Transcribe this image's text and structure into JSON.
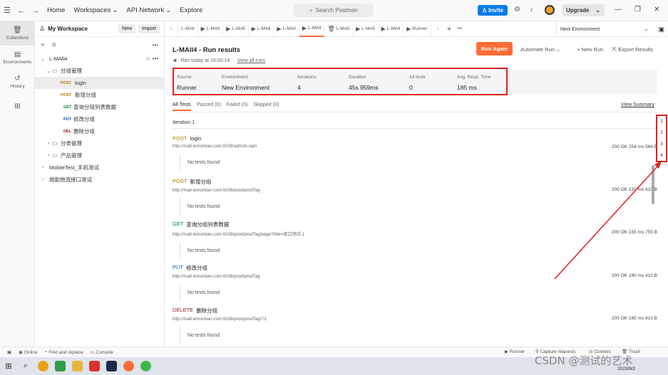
{
  "topbar": {
    "nav": [
      "Home",
      "Workspaces",
      "API Network",
      "Explore"
    ],
    "search_placeholder": "Search Postman",
    "invite": "Invite",
    "upgrade": "Upgrade"
  },
  "rail": [
    {
      "label": "Collections",
      "icon": "trash-can-icon"
    },
    {
      "label": "Environments",
      "icon": "environment-icon"
    },
    {
      "label": "History",
      "icon": "history-icon"
    },
    {
      "label": "",
      "icon": "grid-icon"
    }
  ],
  "sidebar": {
    "workspace": "My Workspace",
    "new_btn": "New",
    "import_btn": "Import",
    "collection": "L-MAll4",
    "folder1": "分组管理",
    "requests": [
      {
        "method": "POST",
        "name": "login"
      },
      {
        "method": "POST",
        "name": "新增分组"
      },
      {
        "method": "GET",
        "name": "查询分组列表数据"
      },
      {
        "method": "PUT",
        "name": "修改分组"
      },
      {
        "method": "DEL",
        "name": "删除分组"
      }
    ],
    "folder2": "分类管理",
    "folder3": "产品管理",
    "col2": "MobileTest_手机测试",
    "col3": "闻能物流接口测试"
  },
  "tabs": [
    "L-MAll",
    "L-MAll",
    "L-MAll",
    "L-MAll",
    "L-MAll",
    "L-MAll",
    "L-MAll",
    "L-MAll",
    "L-MAll",
    "Runner"
  ],
  "environment": "New Environment",
  "run": {
    "title": "L-MAll4 - Run results",
    "ran": "Ran today at 16:00:14",
    "sep": "·",
    "view_all": "View all runs",
    "run_again": "Run Again",
    "automate": "Automate Run",
    "new_run": "New Run",
    "export": "Export Results"
  },
  "stats": [
    {
      "label": "Source",
      "value": "Runner"
    },
    {
      "label": "Environment",
      "value": "New Environment"
    },
    {
      "label": "Iterations",
      "value": "4"
    },
    {
      "label": "Duration",
      "value": "45s 959ms"
    },
    {
      "label": "All tests",
      "value": "0"
    },
    {
      "label": "Avg. Resp. Time",
      "value": "185 ms"
    }
  ],
  "filters": [
    "All Tests",
    "Passed (0)",
    "Failed (0)",
    "Skipped (0)"
  ],
  "view_summary": "View Summary",
  "iteration": "Iteration 1",
  "results": [
    {
      "method": "POST",
      "name": "login",
      "url": "http://mall.lemonban.com:8108/adminLogin",
      "status": "200 OK   254 ms   566 B",
      "tests": "No tests found"
    },
    {
      "method": "POST",
      "name": "新增分组",
      "url": "http://mall.lemonban.com:8108/prod/prodTag",
      "status": "200 OK   155 ms   410 B",
      "tests": "No tests found"
    },
    {
      "method": "GET",
      "name": "查询分组列表数据",
      "url": "http://mall.lemonban.com:8108/prod/prodTag/page?title=接口测试-1",
      "status": "200 OK   155 ms   755 B",
      "tests": "No tests found"
    },
    {
      "method": "PUT",
      "name": "修改分组",
      "url": "http://mall.lemonban.com:8108/prod/prodTag",
      "status": "200 OK   180 ms   410 B",
      "tests": "No tests found"
    },
    {
      "method": "DELETE",
      "name": "删除分组",
      "url": "http://mall.lemonban.com:8108/prod/prodTag/73",
      "status": "200 OK   185 ms   410 B",
      "tests": "No tests found"
    }
  ],
  "iter_nav": [
    "1",
    "2",
    "3",
    "4"
  ],
  "statusbar": {
    "online": "Online",
    "find": "Find and replace",
    "console": "Console",
    "runner": "Runner",
    "capture": "Capture requests",
    "cookies": "Cookies",
    "trash": "Trash"
  },
  "watermark": "CSDN @测试的艺术",
  "date": "2023/9/2"
}
